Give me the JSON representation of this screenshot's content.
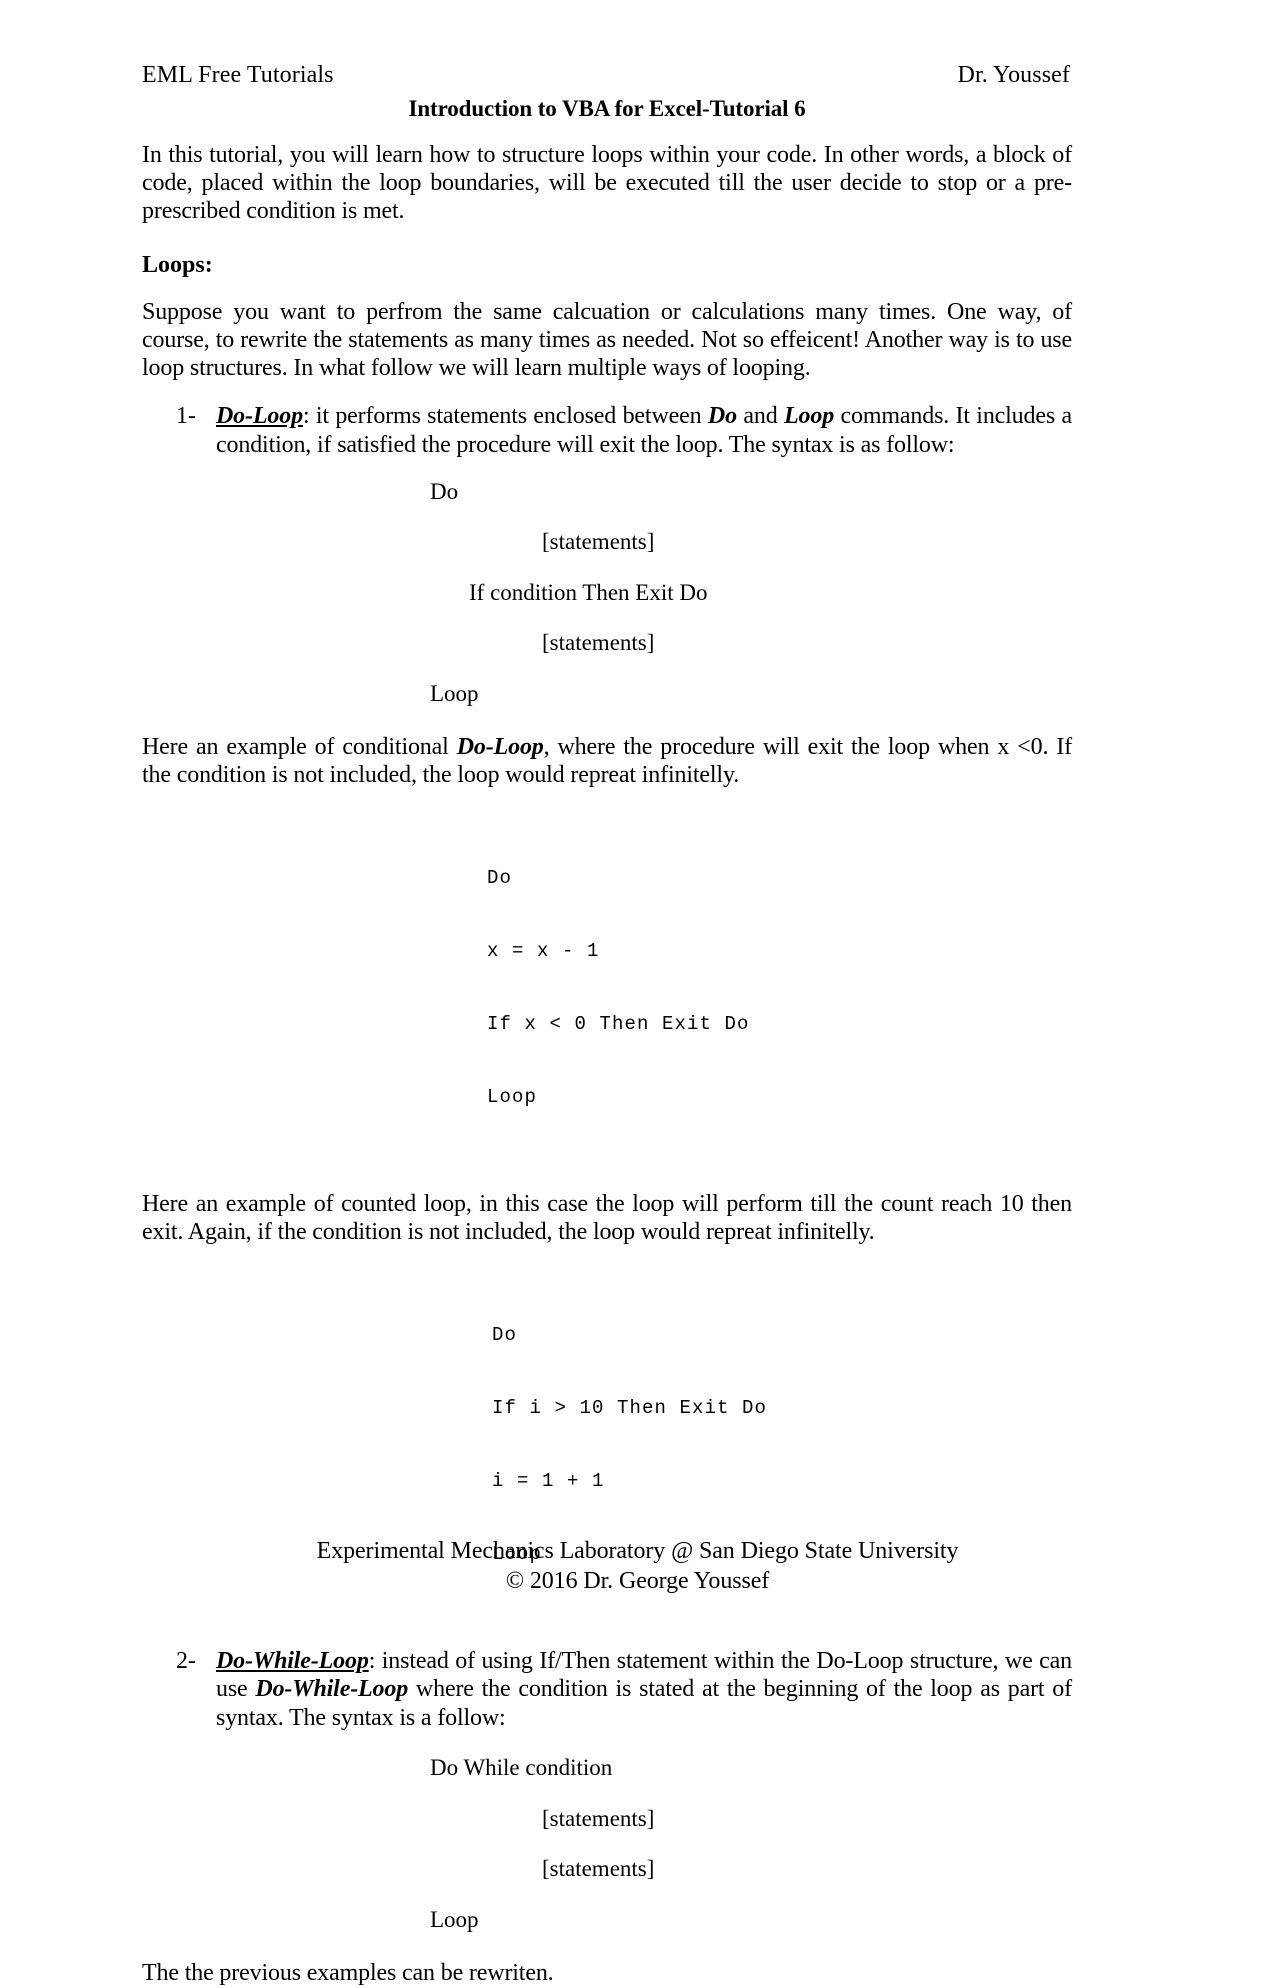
{
  "header": {
    "left": "EML Free Tutorials",
    "right": "Dr. Youssef",
    "title": "Introduction to VBA for Excel-Tutorial 6"
  },
  "intro": {
    "paragraph": "In this tutorial, you will learn how to structure loops within your code.  In other words, a block of code, placed within the loop boundaries, will be executed till the user decide to stop or a pre-prescribed  condition is met."
  },
  "loops_section": {
    "heading": "Loops:",
    "paragraph": "Suppose you want to perfrom the same calcuation or calculations many times. One way, of course, to rewrite the statements as many times as needed. Not so effeicent! Another way is to use loop structures. In what follow we will learn multiple ways of looping."
  },
  "items": [
    {
      "marker": "1-",
      "term": "Do-Loop",
      "text_after_term": ":  it performs statements enclosed between ",
      "kw1": "Do",
      "mid": " and ",
      "kw2": "Loop",
      "tail": " commands. It includes a condition, if satisfied the procedure will exit the loop. The syntax is as follow:"
    },
    {
      "marker": "2-",
      "term": "Do-While-Loop",
      "text_after_term": ": instead of using If/Then statement within the Do-Loop structure, we can use ",
      "kw1": "Do-While-Loop",
      "tail": " where the condition is stated at the beginning of the loop as part of syntax. The syntax is a follow:"
    }
  ],
  "syntax_do_loop": {
    "lines": [
      "Do",
      "[statements]",
      "If condition Then Exit Do",
      "[statements]",
      "Loop"
    ]
  },
  "syntax_do_while_loop": {
    "lines": [
      "Do While condition",
      "[statements]",
      "[statements]",
      "Loop"
    ]
  },
  "example1": {
    "lead_before_kw": "Here an example of conditional ",
    "kw": "Do-Loop",
    "lead_after_kw": ", where the procedure will exit the loop when x <0. If the condition is not included, the loop would repreat infinitelly.",
    "code": [
      "Do",
      "x = x - 1",
      "If x < 0 Then Exit Do",
      "Loop"
    ]
  },
  "example2": {
    "lead": "Here an example of counted loop, in this case the loop will perform till the count reach 10 then exit. Again, if the condition is not included, the loop would repreat infinitelly.",
    "code": [
      "Do",
      "If i > 10 Then Exit Do",
      "i = 1 + 1",
      "Loop"
    ]
  },
  "closing": {
    "paragraph": "The the previous examples can be rewriten."
  },
  "footer": {
    "line1": "Experimental Mechanics Laboratory @ San Diego State University",
    "line2": "© 2016 Dr. George Youssef"
  }
}
